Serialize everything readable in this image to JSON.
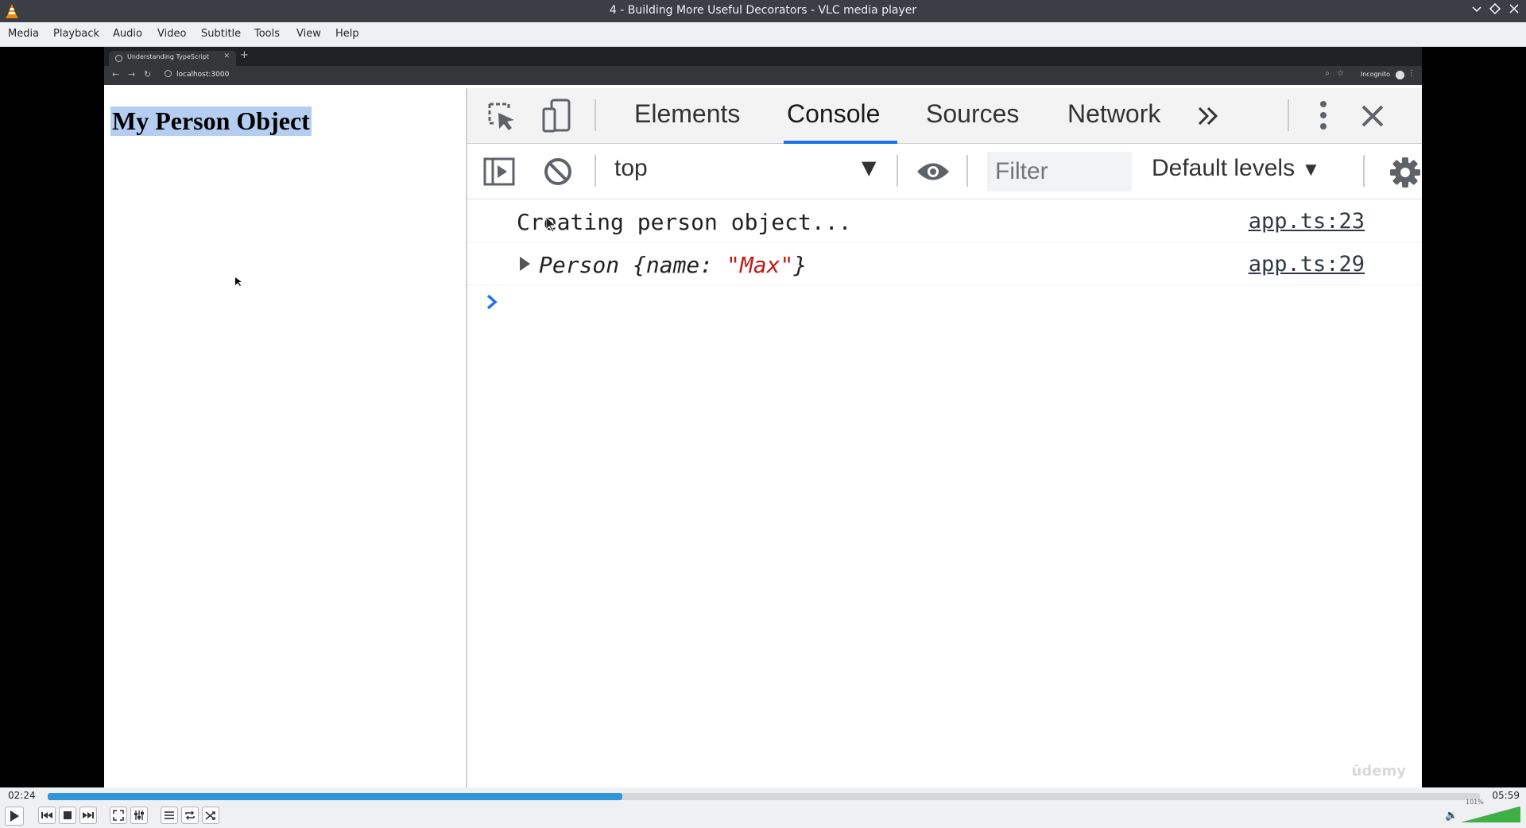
{
  "window": {
    "title": "4 - Building More Useful Decorators - VLC media player"
  },
  "menu": [
    "Media",
    "Playback",
    "Audio",
    "Video",
    "Subtitle",
    "Tools",
    "View",
    "Help"
  ],
  "browser": {
    "tab_title": "Understanding TypeScript",
    "url": "localhost:3000",
    "profile_label": "Incognito"
  },
  "page": {
    "heading": "My Person Object"
  },
  "devtools": {
    "tabs": [
      "Elements",
      "Console",
      "Sources",
      "Network"
    ],
    "active_tab": "Console",
    "context": "top",
    "filter_placeholder": "Filter",
    "levels": "Default levels",
    "logs": [
      {
        "text": "Creating person object...",
        "source": "app.ts:23"
      },
      {
        "class_name": "Person",
        "prefix": "Person {name: ",
        "value": "\"Max\"",
        "suffix": "}",
        "source": "app.ts:29"
      }
    ],
    "watermark": "ūdemy"
  },
  "player": {
    "elapsed": "02:24",
    "total": "05:59",
    "progress_fraction": 0.401,
    "volume_label": "101%",
    "volume_fraction": 1.0
  },
  "colors": {
    "accent": "#3196d8",
    "devtools_active": "#1a73e8",
    "string_red": "#c41a16",
    "selection": "#b4cdf0"
  }
}
